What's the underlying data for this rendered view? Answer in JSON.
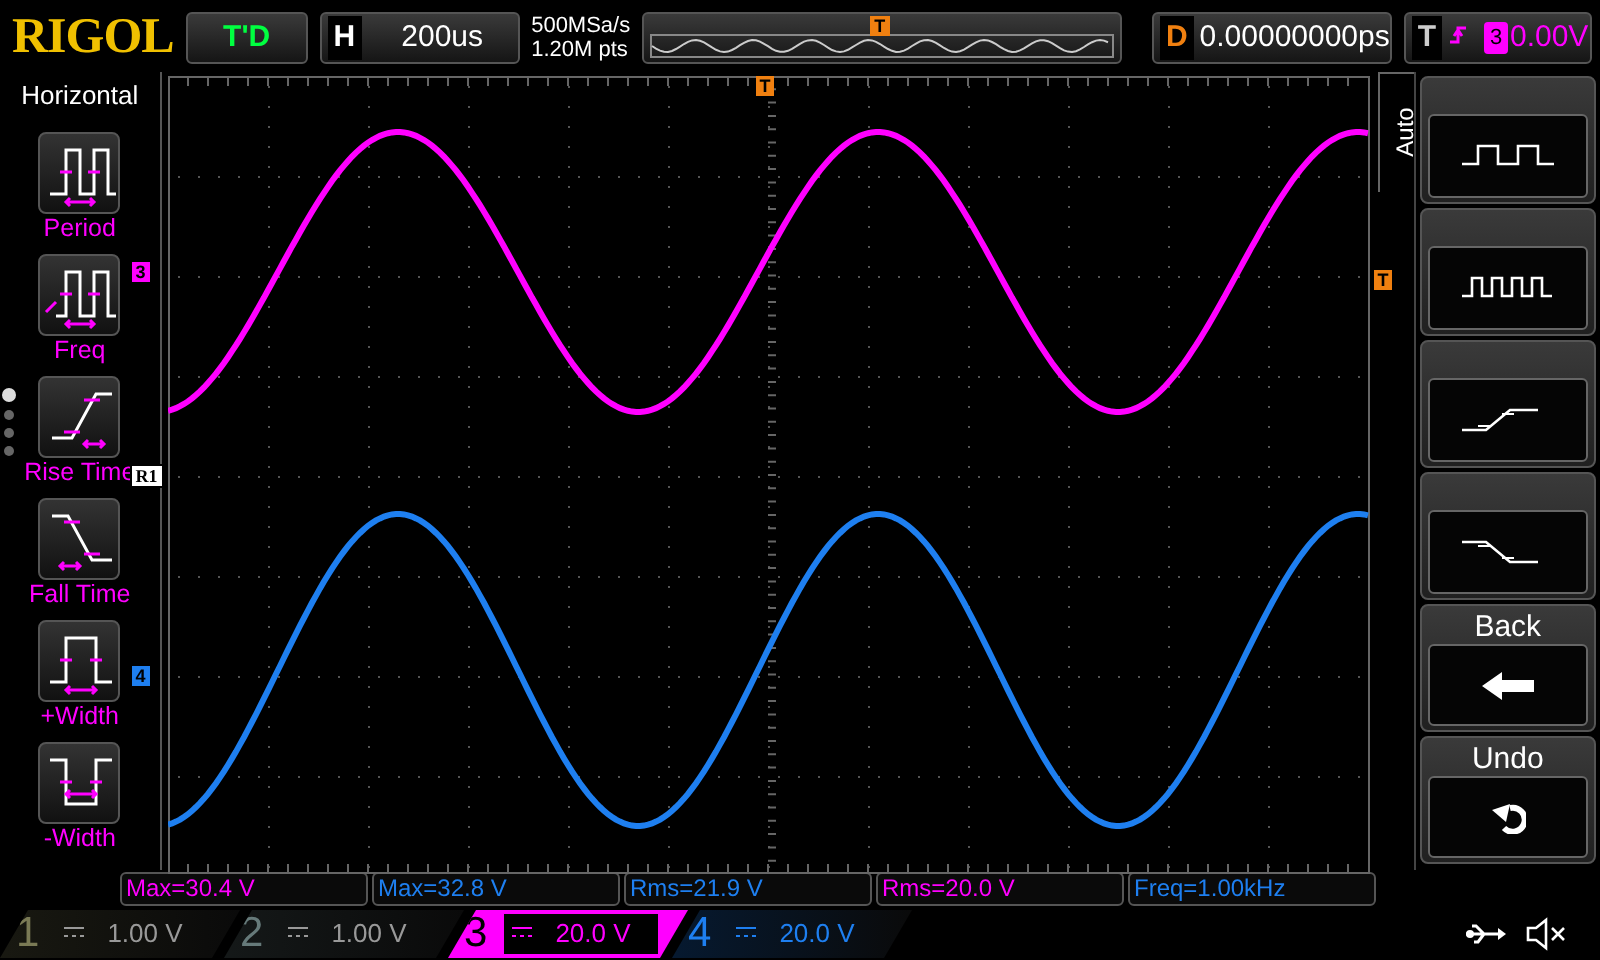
{
  "brand": "RIGOL",
  "status": "T'D",
  "horizontal": {
    "label": "H",
    "timebase": "200us"
  },
  "acquisition": {
    "sample_rate": "500MSa/s",
    "memory_depth": "1.20M pts"
  },
  "delay": {
    "label": "D",
    "value": "0.00000000ps"
  },
  "trigger": {
    "label": "T",
    "source": "3",
    "level": "0.00V",
    "color": "#ff00ff"
  },
  "left_menu": {
    "title": "Horizontal",
    "items": [
      {
        "kind": "period",
        "label": "Period"
      },
      {
        "kind": "freq",
        "label": "Freq"
      },
      {
        "kind": "rise",
        "label": "Rise Time"
      },
      {
        "kind": "fall",
        "label": "Fall Time"
      },
      {
        "kind": "pwidth",
        "label": "+Width"
      },
      {
        "kind": "nwidth",
        "label": "-Width"
      }
    ],
    "pages": [
      {
        "selected": true
      },
      {
        "selected": false
      },
      {
        "selected": false
      },
      {
        "selected": false
      }
    ]
  },
  "markers": [
    {
      "kind": "channel",
      "label": "3",
      "color": "#ff00ff"
    },
    {
      "kind": "ref",
      "label": "R1",
      "color": "#ffffff"
    },
    {
      "kind": "channel",
      "label": "4",
      "color": "#1e7ff0"
    }
  ],
  "trigger_markers": [
    {
      "kind": "overview",
      "label": "T"
    },
    {
      "kind": "position",
      "label": "T"
    },
    {
      "kind": "level",
      "label": "T"
    }
  ],
  "right_menu": {
    "tab": "Auto",
    "items": [
      {
        "kind": "square"
      },
      {
        "kind": "pulse"
      },
      {
        "kind": "rise"
      },
      {
        "kind": "fall"
      },
      {
        "kind": "back",
        "label": "Back"
      },
      {
        "kind": "undo",
        "label": "Undo"
      }
    ]
  },
  "measurements": [
    {
      "text": "Max=30.4 V",
      "color": "#ff00ff"
    },
    {
      "text": "Max=32.8 V",
      "color": "#1e7ff0"
    },
    {
      "text": "Rms=21.9 V",
      "color": "#1e7ff0"
    },
    {
      "text": "Rms=20.0 V",
      "color": "#ff00ff"
    },
    {
      "text": "Freq=1.00kHz",
      "color": "#1e7ff0"
    }
  ],
  "channels": [
    {
      "number": "1",
      "scale": "1.00 V",
      "color": "#7a7a55",
      "selected": false
    },
    {
      "number": "2",
      "scale": "1.00 V",
      "color": "#667a7a",
      "selected": false
    },
    {
      "number": "3",
      "scale": "20.0 V",
      "color": "#ff00ff",
      "selected": true
    },
    {
      "number": "4",
      "scale": "20.0 V",
      "color": "#1e7ff0",
      "selected": false
    }
  ]
}
